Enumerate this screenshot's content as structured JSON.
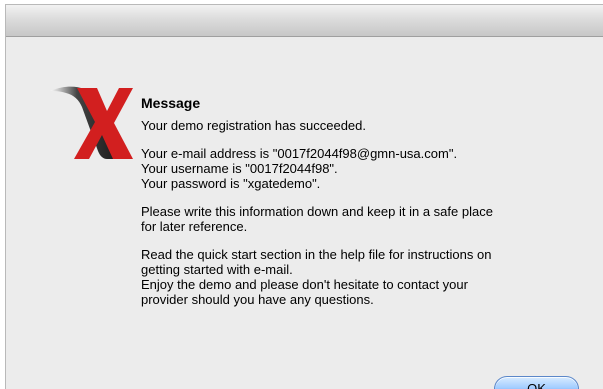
{
  "dialog": {
    "title": "Message",
    "paragraph1": "Your demo registration has succeeded.",
    "paragraph2": "Your e-mail address is \"0017f2044f98@gmn-usa.com\".\nYour username is \"0017f2044f98\".\nYour password is \"xgatedemo\".",
    "paragraph3": "Please write this information down and keep it in a safe place\nfor later reference.",
    "paragraph4": "Read the quick start section in the help file for instructions on\ngetting started with e-mail.\nEnjoy the demo and please don't hesitate to contact your\nprovider should you have any questions.",
    "ok_label": "OK"
  },
  "icon": {
    "name": "xgate-x-logo-icon",
    "colors": {
      "red": "#d21f1f",
      "black": "#111111"
    }
  }
}
